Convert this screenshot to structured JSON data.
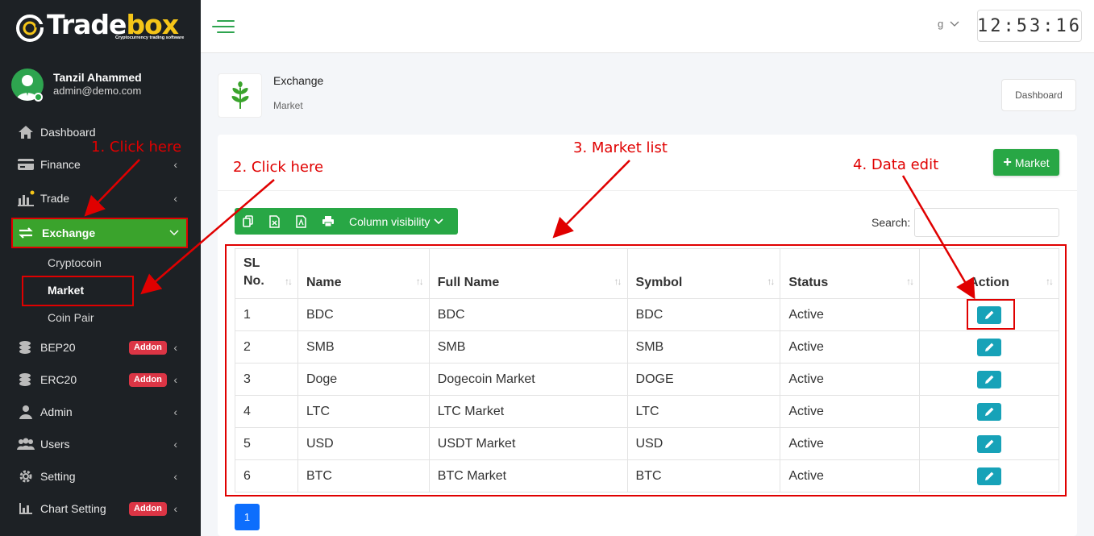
{
  "brand": {
    "name_part1": "Trade",
    "name_part2": "box",
    "tagline": "Cryptocurrency trading software"
  },
  "user": {
    "name": "Tanzil Ahammed",
    "email": "admin@demo.com"
  },
  "sidebar": {
    "items": [
      {
        "label": "Dashboard",
        "icon": "home-icon"
      },
      {
        "label": "Finance",
        "icon": "card-icon"
      },
      {
        "label": "Trade",
        "icon": "chart-icon"
      },
      {
        "label": "Exchange",
        "icon": "exchange-icon"
      },
      {
        "label": "BEP20",
        "icon": "coins-icon",
        "badge": "Addon"
      },
      {
        "label": "ERC20",
        "icon": "coins-icon",
        "badge": "Addon"
      },
      {
        "label": "Admin",
        "icon": "user-icon"
      },
      {
        "label": "Users",
        "icon": "users-icon"
      },
      {
        "label": "Setting",
        "icon": "gear-icon"
      },
      {
        "label": "Chart Setting",
        "icon": "bar-chart-icon",
        "badge": "Addon"
      }
    ],
    "exchange_sub": [
      "Cryptocoin",
      "Market",
      "Coin Pair"
    ]
  },
  "topbar": {
    "lang": "g",
    "clock": "12:53:16"
  },
  "page": {
    "title": "Exchange",
    "subtitle": "Market",
    "dashboard_button": "Dashboard"
  },
  "card": {
    "add_button": "Market",
    "column_visibility": "Column visibility",
    "search_label": "Search:",
    "columns": [
      "SL No.",
      "Name",
      "Full Name",
      "Symbol",
      "Status",
      "Action"
    ],
    "rows": [
      [
        "1",
        "BDC",
        "BDC",
        "BDC",
        "Active"
      ],
      [
        "2",
        "SMB",
        "SMB",
        "SMB",
        "Active"
      ],
      [
        "3",
        "Doge",
        "Dogecoin Market",
        "DOGE",
        "Active"
      ],
      [
        "4",
        "LTC",
        "LTC Market",
        "LTC",
        "Active"
      ],
      [
        "5",
        "USD",
        "USDT Market",
        "USD",
        "Active"
      ],
      [
        "6",
        "BTC",
        "BTC Market",
        "BTC",
        "Active"
      ]
    ],
    "page": "1"
  },
  "annotations": {
    "step1": "1. Click here",
    "step2": "2. Click here",
    "step3": "3. Market list",
    "step4": "4. Data edit"
  },
  "colors": {
    "accent": "#28a745",
    "sidebar_bg": "#1d2125",
    "annotation": "#e00000",
    "edit": "#17a2b8"
  }
}
